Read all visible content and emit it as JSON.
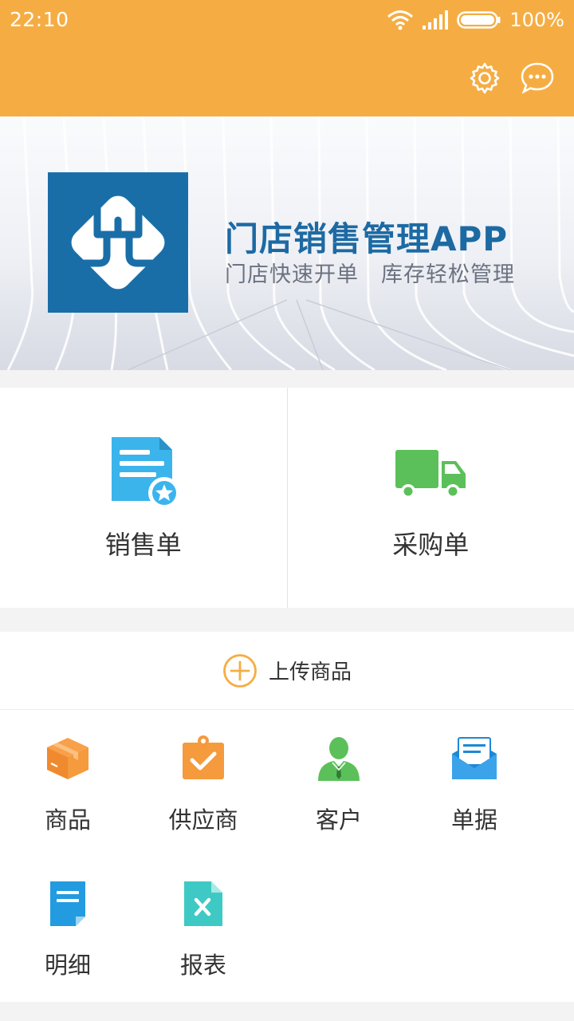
{
  "status_bar": {
    "time": "22:10",
    "battery": "100%"
  },
  "header": {
    "icons": [
      "gear-icon",
      "chat-icon"
    ],
    "accent": "#f5ad43"
  },
  "banner": {
    "title": "门店销售管理APP",
    "subtitle": "门店快速开单　库存轻松管理"
  },
  "main_actions": [
    {
      "label": "销售单",
      "icon": "sales-order-icon",
      "color": "#3bb4ec"
    },
    {
      "label": "采购单",
      "icon": "truck-icon",
      "color": "#5cc05a"
    }
  ],
  "upload": {
    "label": "上传商品"
  },
  "grid": [
    {
      "label": "商品",
      "icon": "box-icon"
    },
    {
      "label": "供应商",
      "icon": "supplier-icon"
    },
    {
      "label": "客户",
      "icon": "customer-icon"
    },
    {
      "label": "单据",
      "icon": "envelope-icon"
    },
    {
      "label": "明细",
      "icon": "detail-icon"
    },
    {
      "label": "报表",
      "icon": "report-icon"
    }
  ]
}
